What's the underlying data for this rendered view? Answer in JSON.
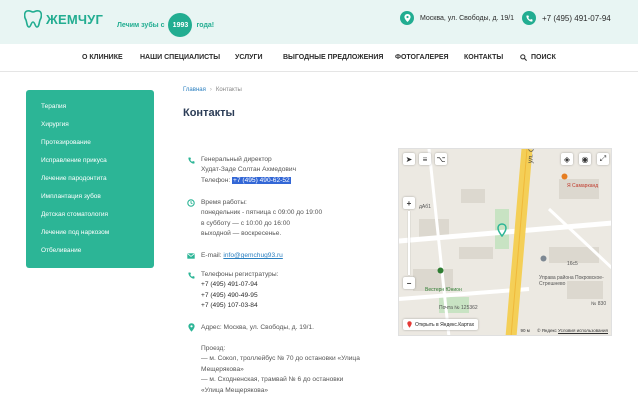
{
  "header": {
    "logo_text": "ЖЕМЧУГ",
    "tagline_before": "Лечим зубы с",
    "year": "1993",
    "tagline_after": "года!",
    "address": "Москва, ул. Свободы, д. 19/1",
    "phone": "+7 (495) 491-07-94",
    "brand_color": "#22ad91"
  },
  "nav": {
    "items": [
      "О КЛИНИКЕ",
      "НАШИ СПЕЦИАЛИСТЫ",
      "УСЛУГИ",
      "ВЫГОДНЫЕ ПРЕДЛОЖЕНИЯ",
      "ФОТОГАЛЕРЕЯ",
      "КОНТАКТЫ"
    ],
    "search_label": "ПОИСК"
  },
  "sidebar": {
    "items": [
      "Терапия",
      "Хирургия",
      "Протезирование",
      "Исправление прикуса",
      "Лечение пародонтита",
      "Имплантация зубов",
      "Детская стоматология",
      "Лечение под наркозом",
      "Отбеливание"
    ]
  },
  "breadcrumb": {
    "home": "Главная",
    "current": "Контакты"
  },
  "page_title": "Контакты",
  "contacts": {
    "director": {
      "title": "Генеральный директор",
      "name": "Худат-Заде Солтан Ахмедович",
      "phone_label": "Телефон:",
      "phone": "+7 (495) 490-62-52"
    },
    "hours": {
      "title": "Время работы:",
      "weekdays": "понедельник - пятница с 09:00 до 19:00",
      "saturday": "в субботу — с 10:00 до 16:00",
      "sunday": "выходной — воскресенье."
    },
    "email": {
      "label": "E-mail:",
      "value": "info@gemchug93.ru"
    },
    "registry": {
      "title": "Телефоны регистратуры:",
      "phones": [
        "+7 (495) 491-07-94",
        "+7 (495) 490-49-95",
        "+7 (495) 107-03-84"
      ]
    },
    "address": "Адрес: Москва, ул. Свободы, д. 19/1.",
    "directions": {
      "title": "Проезд:",
      "lines": [
        "— м. Сокол, троллейбус № 70 до остановки «Улица",
        "Мещерякова»",
        "— м. Сходненская, трамвай № 6 до остановки",
        "«Улица Мещерякова»"
      ]
    }
  },
  "map": {
    "labels": {
      "street": "ул. Свободы",
      "samarkand": "Я Самарканд",
      "building_1": "дАб1",
      "building_16c5": "16с5",
      "admin": "Управа района Покровское-Стрешнево",
      "vestern": "Вестерн Юнион",
      "post": "Почта № 125362",
      "num_830": "№ 830"
    },
    "open_label": "Открыть в Яндекс.Картах",
    "scale": "90 м",
    "copyright": "© Яндекс",
    "terms": "Условия использования"
  }
}
